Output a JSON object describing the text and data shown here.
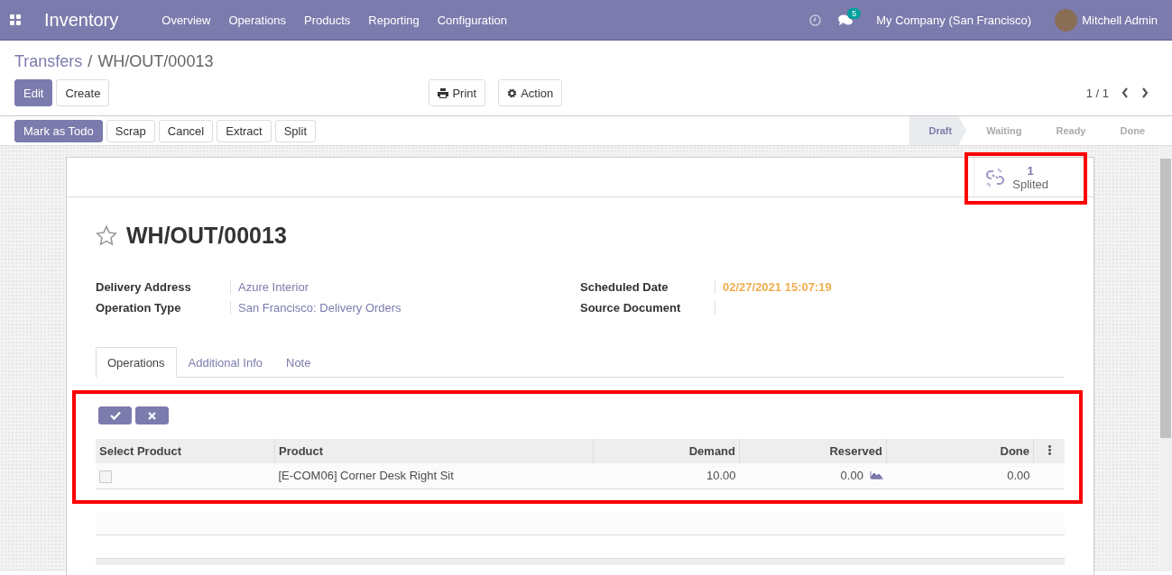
{
  "navbar": {
    "app_name": "Inventory",
    "menu": [
      "Overview",
      "Operations",
      "Products",
      "Reporting",
      "Configuration"
    ],
    "messages_count": "5",
    "company": "My Company (San Francisco)",
    "user": "Mitchell Admin"
  },
  "breadcrumb": {
    "parent": "Transfers",
    "separator": "/",
    "current": "WH/OUT/00013"
  },
  "main_buttons": [
    {
      "label": "Edit",
      "primary": true
    },
    {
      "label": "Create",
      "primary": false
    }
  ],
  "print_actions": [
    {
      "label": "Print",
      "kind": "print"
    },
    {
      "label": "Action",
      "kind": "gear"
    }
  ],
  "pager": {
    "value": "1 / 1"
  },
  "header_buttons": [
    {
      "label": "Mark as Todo",
      "primary": true
    },
    {
      "label": "Scrap",
      "primary": false
    },
    {
      "label": "Cancel",
      "primary": false
    },
    {
      "label": "Extract",
      "primary": false
    },
    {
      "label": "Split",
      "primary": false
    }
  ],
  "status_steps": [
    {
      "label": "Draft",
      "selected": true
    },
    {
      "label": "Waiting",
      "selected": false
    },
    {
      "label": "Ready",
      "selected": false
    },
    {
      "label": "Done",
      "selected": false
    }
  ],
  "smart_button": {
    "count": "1",
    "label": "Splited"
  },
  "record": {
    "title": "WH/OUT/00013",
    "starred": false
  },
  "fields_left": [
    {
      "label": "Delivery Address",
      "value": "Azure Interior"
    },
    {
      "label": "Operation Type",
      "value": "San Francisco: Delivery Orders"
    }
  ],
  "fields_right": [
    {
      "label": "Scheduled Date",
      "value": "02/27/2021 15:07:19"
    },
    {
      "label": "Source Document"
    }
  ],
  "tabs": [
    {
      "label": "Operations",
      "selected": true
    },
    {
      "label": "Additional Info",
      "selected": false
    },
    {
      "label": "Note",
      "selected": false
    }
  ],
  "table": {
    "columns": [
      "Select Product",
      "Product",
      "Demand",
      "Reserved",
      "Done"
    ],
    "rows": [
      {
        "checked": false,
        "product": "[E-COM06] Corner Desk Right Sit",
        "demand": "10.00",
        "reserved": "0.00",
        "done": "0.00"
      }
    ]
  }
}
